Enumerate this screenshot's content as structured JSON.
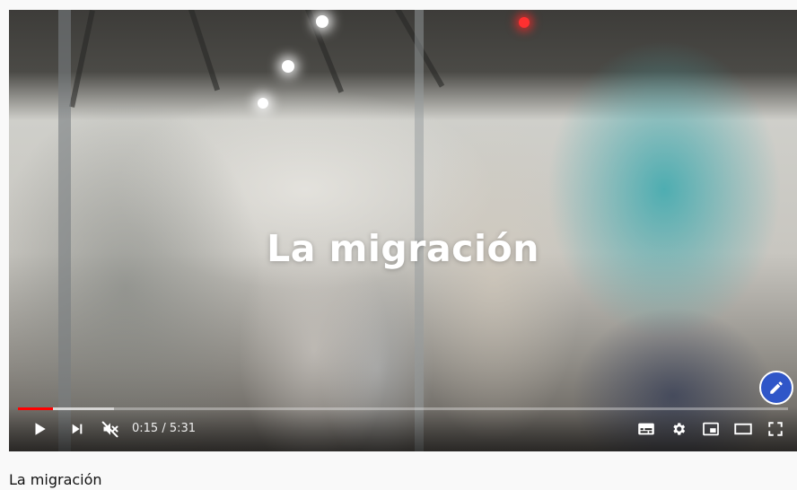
{
  "video": {
    "overlay_title": "La migración",
    "playback": {
      "current_time": "0:15",
      "separator": " / ",
      "duration": "5:31",
      "played_fraction": 0.045,
      "buffered_fraction": 0.125
    }
  },
  "controls": {
    "left": [
      "play-icon",
      "next-icon",
      "mute-icon"
    ],
    "right": [
      "subtitles-icon",
      "settings-icon",
      "miniplayer-icon",
      "theater-icon",
      "fullscreen-icon"
    ]
  },
  "edit_button_icon": "pencil-icon",
  "title": "La migración",
  "colors": {
    "progress_played": "#ff0000",
    "edit_button": "#2f56c8"
  }
}
